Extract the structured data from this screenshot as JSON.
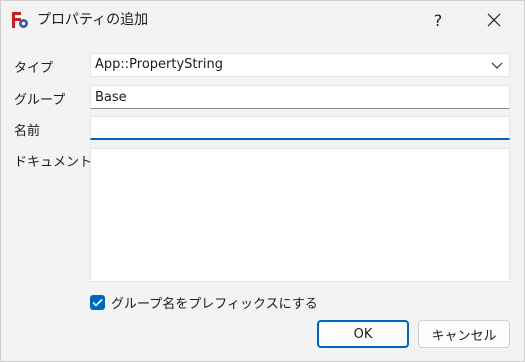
{
  "window": {
    "title": "プロパティの追加",
    "help_label": "?",
    "close_icon": "close-icon"
  },
  "form": {
    "type_label": "タイプ",
    "type_value": "App::PropertyString",
    "group_label": "グループ",
    "group_value": "Base",
    "name_label": "名前",
    "name_value": "",
    "doc_label": "ドキュメント",
    "doc_value": "",
    "prefix_checkbox_label": "グループ名をプレフィックスにする",
    "prefix_checked": true
  },
  "buttons": {
    "ok": "OK",
    "cancel": "キャンセル"
  },
  "colors": {
    "accent": "#0067c0",
    "window_bg": "#f3f3f3",
    "field_bg": "#ffffff"
  }
}
